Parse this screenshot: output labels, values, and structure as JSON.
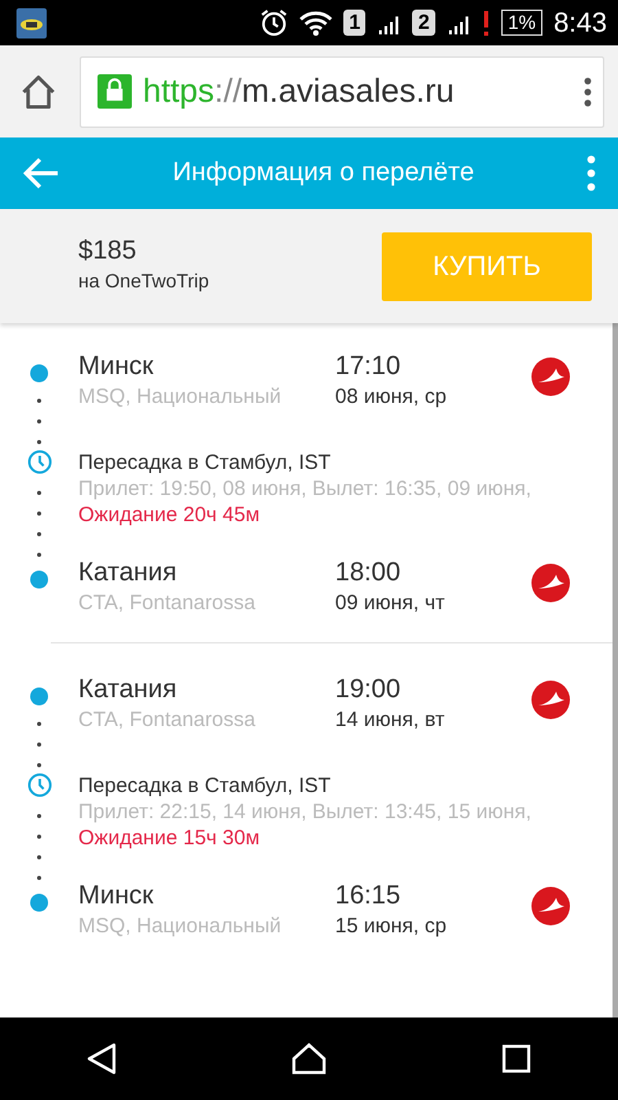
{
  "status_bar": {
    "sim_1": "1",
    "sim_2": "2",
    "battery": "1%",
    "time": "8:43"
  },
  "browser": {
    "url_scheme": "https",
    "url_separator": "://",
    "url_host": "m.aviasales.ru"
  },
  "app_bar": {
    "title": "Информация о перелёте"
  },
  "offer": {
    "price": "$185",
    "vendor": "на OneTwoTrip",
    "buy_button": "КУПИТЬ"
  },
  "legs": [
    {
      "segments": [
        {
          "kind": "stop",
          "city": "Минск",
          "airport": "MSQ, Национальный",
          "time": "17:10",
          "date": "08 июня, ср"
        },
        {
          "kind": "transfer",
          "title": "Пересадка в Стамбул, IST",
          "details": "Прилет: 19:50, 08 июня, Вылет: 16:35, 09 июня,",
          "wait": "Ожидание 20ч 45м"
        },
        {
          "kind": "stop",
          "city": "Катания",
          "airport": "CTA, Fontanarossa",
          "time": "18:00",
          "date": "09 июня, чт"
        }
      ]
    },
    {
      "segments": [
        {
          "kind": "stop",
          "city": "Катания",
          "airport": "CTA, Fontanarossa",
          "time": "19:00",
          "date": "14 июня, вт"
        },
        {
          "kind": "transfer",
          "title": "Пересадка в Стамбул, IST",
          "details": "Прилет: 22:15, 14 июня, Вылет: 13:45, 15 июня,",
          "wait": "Ожидание 15ч 30м"
        },
        {
          "kind": "stop",
          "city": "Минск",
          "airport": "MSQ, Национальный",
          "time": "16:15",
          "date": "15 июня, ср"
        }
      ]
    }
  ]
}
